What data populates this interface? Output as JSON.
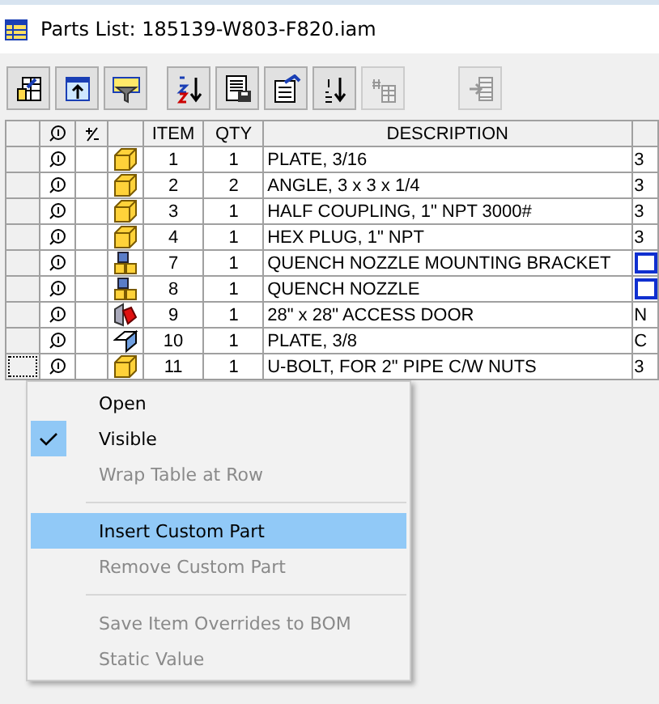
{
  "window": {
    "title": "Parts List: 185139-W803-F820.iam"
  },
  "toolbar": [
    {
      "kind": "view",
      "disabled": false
    },
    {
      "kind": "export",
      "disabled": false
    },
    {
      "kind": "filter",
      "disabled": false
    },
    {
      "kind": "sort",
      "disabled": false
    },
    {
      "kind": "save",
      "disabled": false
    },
    {
      "kind": "properties",
      "disabled": false
    },
    {
      "kind": "renumber",
      "disabled": false
    },
    {
      "kind": "merge",
      "disabled": true
    },
    {
      "kind": "insert",
      "disabled": true
    }
  ],
  "table": {
    "columns": [
      "ITEM",
      "QTY",
      "DESCRIPTION"
    ],
    "rows": [
      {
        "item": "1",
        "qty": "1",
        "description": "PLATE, 3/16",
        "column_7": "3",
        "kind": "part",
        "flagged": false,
        "focused": false
      },
      {
        "item": "2",
        "qty": "2",
        "description": "ANGLE, 3 x 3 x 1/4",
        "column_7": "3",
        "kind": "part",
        "flagged": false,
        "focused": false
      },
      {
        "item": "3",
        "qty": "1",
        "description": "HALF COUPLING, 1\" NPT 3000#",
        "column_7": "3",
        "kind": "part",
        "flagged": false,
        "focused": false
      },
      {
        "item": "4",
        "qty": "1",
        "description": "HEX PLUG, 1\" NPT",
        "column_7": "3",
        "kind": "part",
        "flagged": false,
        "focused": false
      },
      {
        "item": "7",
        "qty": "1",
        "description": "QUENCH NOZZLE MOUNTING BRACKET",
        "kind": "assembly",
        "flagged": true,
        "focused": false
      },
      {
        "item": "8",
        "qty": "1",
        "description": "QUENCH NOZZLE",
        "kind": "assembly",
        "flagged": true,
        "focused": false
      },
      {
        "item": "9",
        "qty": "1",
        "description": "28\" x 28\" ACCESS DOOR",
        "column_7": "N",
        "kind": "weldment",
        "flagged": false,
        "focused": false
      },
      {
        "item": "10",
        "qty": "1",
        "description": "PLATE, 3/8",
        "column_7": "C",
        "kind": "sheet",
        "flagged": false,
        "focused": false
      },
      {
        "item": "11",
        "qty": "1",
        "description": "U-BOLT, FOR 2\" PIPE C/W NUTS",
        "column_7": "3",
        "kind": "part",
        "flagged": false,
        "focused": true
      }
    ]
  },
  "context_menu": [
    {
      "label": "Open",
      "kind": "item",
      "checked": false,
      "disabled": false,
      "selected": false
    },
    {
      "label": "Visible",
      "kind": "item",
      "checked": true,
      "disabled": false,
      "selected": false
    },
    {
      "label": "Wrap Table at Row",
      "kind": "item",
      "checked": false,
      "disabled": true,
      "selected": false
    },
    {
      "kind": "separator"
    },
    {
      "label": "Insert Custom Part",
      "kind": "item",
      "checked": false,
      "disabled": false,
      "selected": true
    },
    {
      "label": "Remove Custom Part",
      "kind": "item",
      "checked": false,
      "disabled": true,
      "selected": false
    },
    {
      "kind": "separator"
    },
    {
      "label": "Save Item Overrides to BOM",
      "kind": "item",
      "checked": false,
      "disabled": true,
      "selected": false
    },
    {
      "label": "Static Value",
      "kind": "item",
      "checked": false,
      "disabled": true,
      "selected": false
    }
  ]
}
